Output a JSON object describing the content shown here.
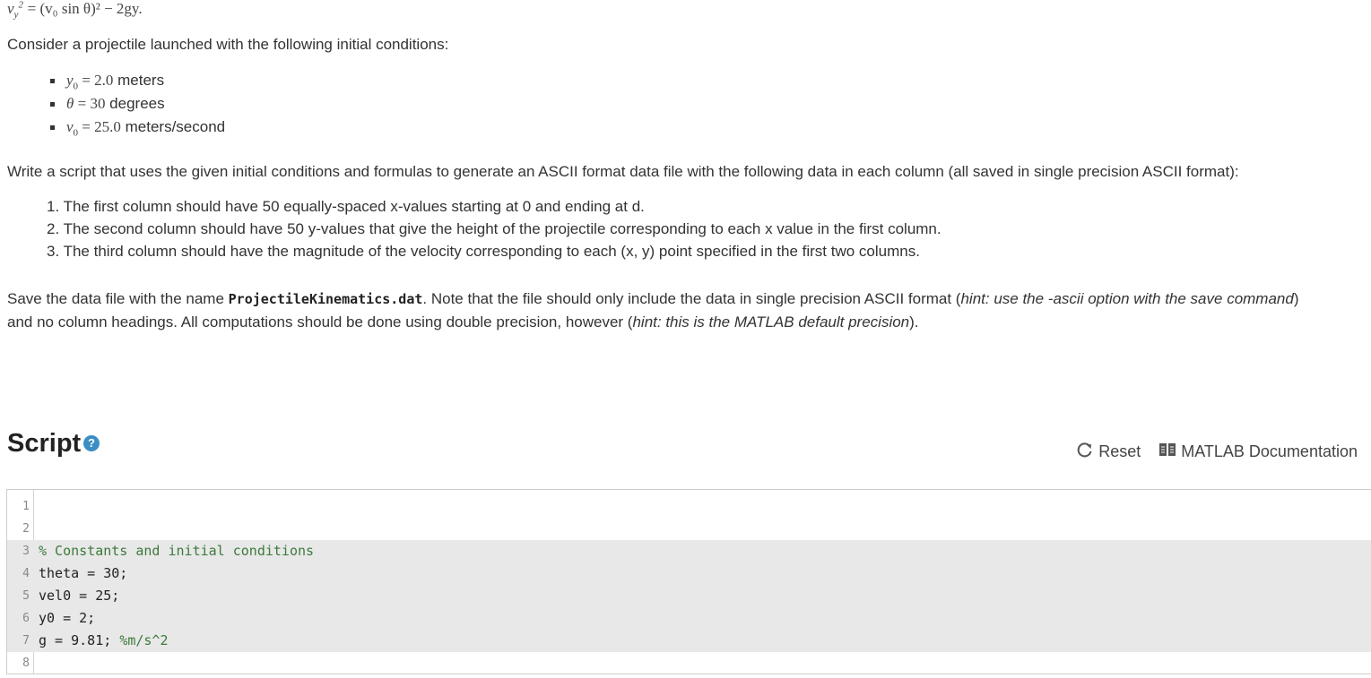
{
  "formula_text": "= (v₀ sin θ)² − 2gy.",
  "intro": "Consider a projectile launched with the following initial conditions:",
  "conditions": [
    {
      "sym": "y",
      "sub": "0",
      "eq": " = 2.0",
      "unit": " meters"
    },
    {
      "sym": "θ",
      "sub": "",
      "eq": " = 30",
      "unit": " degrees"
    },
    {
      "sym": "v",
      "sub": "0",
      "eq": " = 25.0",
      "unit": " meters/second"
    }
  ],
  "task": "Write a script that uses the given initial conditions and formulas to generate an ASCII format data file with the following data in each column (all saved in single precision ASCII format):",
  "steps": [
    "1. The first column should have 50 equally-spaced x-values starting at 0 and ending at d.",
    "2. The second column should have 50 y-values that give the height of the projectile corresponding to each x value in the first column.",
    "3. The third column should have the magnitude of the velocity corresponding to each (x, y) point specified in the first two columns."
  ],
  "save": {
    "pre": "Save the data file with the name ",
    "filename": "ProjectileKinematics.dat",
    "mid": ". Note that the file should only include the data in single precision ASCII format (",
    "hint1": "hint: use the -ascii option with the save command",
    "mid2": ") and no column headings. All computations should be done using double precision, however (",
    "hint2": "hint: this is the MATLAB default precision",
    "end": ")."
  },
  "script_title": "Script",
  "help_symbol": "?",
  "toolbar": {
    "reset_label": "Reset",
    "docs_label": "MATLAB Documentation"
  },
  "icons": {
    "help": "help-icon",
    "reset": "reset-icon",
    "docs": "book-icon"
  },
  "colors": {
    "help_blue": "#3b8ec4",
    "comment_green": "#3c7a3c",
    "highlight": "#e8e8e8"
  },
  "code_lines": [
    {
      "n": "1",
      "code": "",
      "comment": "",
      "hl": false
    },
    {
      "n": "2",
      "code": "",
      "comment": "",
      "hl": false
    },
    {
      "n": "3",
      "code": "",
      "comment": "% Constants and initial conditions",
      "hl": true
    },
    {
      "n": "4",
      "code": "theta = 30;",
      "comment": "",
      "hl": true
    },
    {
      "n": "5",
      "code": "vel0 = 25;",
      "comment": "",
      "hl": true
    },
    {
      "n": "6",
      "code": "y0 = 2;",
      "comment": "",
      "hl": true
    },
    {
      "n": "7",
      "code": "g = 9.81; ",
      "comment": "%m/s^2",
      "hl": true
    },
    {
      "n": "8",
      "code": "",
      "comment": "",
      "hl": false
    }
  ]
}
